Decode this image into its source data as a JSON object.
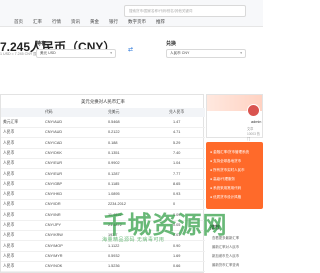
{
  "header": {
    "search_placeholder": "搜索货币/国家名称/代码/别名/其他关键词",
    "nav": [
      "首页",
      "汇率",
      "行情",
      "资讯",
      "黄金",
      "银行",
      "数字货币",
      "推荐"
    ]
  },
  "page": {
    "title": "7.245人民币（CNY）",
    "subtitle": "1 USD = 7.245 CNY  国际汇率 · 2025-07-11 07:30:00"
  },
  "converter": {
    "from_label": "持有",
    "from_value": "美元 USD",
    "to_label": "兑换",
    "to_value": "人民币 CNY",
    "swap_icon": "swap-icon"
  },
  "table": {
    "title": "美元兑换对人民币汇率",
    "columns": [
      "",
      "代码",
      "兑美元",
      "兑人民币"
    ],
    "rows": [
      {
        "name": "美元汇率",
        "code": "CNY/AUD",
        "v1": "0.5468",
        "v2": "1.47"
      },
      {
        "name": "人民币",
        "code": "CNY/AUD",
        "v1": "0.2122",
        "v2": "4.71"
      },
      {
        "name": "人民币",
        "code": "CNY/CAD",
        "v1": "0.188",
        "v2": "5.29"
      },
      {
        "name": "人民币",
        "code": "CNY/DKK",
        "v1": "0.1351",
        "v2": "7.40"
      },
      {
        "name": "人民币",
        "code": "CNY/EUR",
        "v1": "0.9902",
        "v2": "1.04"
      },
      {
        "name": "人民币",
        "code": "CNY/EUR",
        "v1": "0.1287",
        "v2": "7.77"
      },
      {
        "name": "人民币",
        "code": "CNY/GBP",
        "v1": "0.1185",
        "v2": "8.65"
      },
      {
        "name": "人民币",
        "code": "CNY/HKD",
        "v1": "1.0895",
        "v2": "0.93"
      },
      {
        "name": "人民币",
        "code": "CNY/IDR",
        "v1": "2234.2012",
        "v2": "0"
      },
      {
        "name": "人民币",
        "code": "CNY/INR",
        "v1": "11.4899",
        "v2": "0.09"
      },
      {
        "name": "人民币",
        "code": "CNY/JPY",
        "v1": "21.4872",
        "v2": "0.05"
      },
      {
        "name": "人民币",
        "code": "CNY/KRW",
        "v1": "193.7",
        "v2": "0.01"
      },
      {
        "name": "人民币",
        "code": "CNY/MOP",
        "v1": "1.1122",
        "v2": "0.90"
      },
      {
        "name": "人民币",
        "code": "CNY/MYR",
        "v1": "0.5932",
        "v2": "1.69"
      },
      {
        "name": "人民币",
        "code": "CNY/NOK",
        "v1": "1.5236",
        "v2": "0.66"
      }
    ]
  },
  "sidebar": {
    "user_name": "admin",
    "user_stat": "文章 10003 热门",
    "ad_items": [
      "● 金融汇率/货币管理系统",
      "● 支持全球各地货币",
      "● 所有货币实时人民币",
      "● 高级/代理服务",
      "● 系统采用常用代码",
      "● 优质货币设计风格"
    ],
    "rec_title": "推荐",
    "rec_items": [
      "查看更多最新汇率",
      "最新汇率对人民币",
      "新加坡币兑人民币",
      "最新货币汇率查询"
    ]
  },
  "watermark": {
    "text": "千城资源网",
    "sub": "海量精品源码 无病毒可用"
  },
  "colors": {
    "accent": "#1e6fd9",
    "ad_bg": "#ff6a2a",
    "watermark": "#2f9e44"
  }
}
